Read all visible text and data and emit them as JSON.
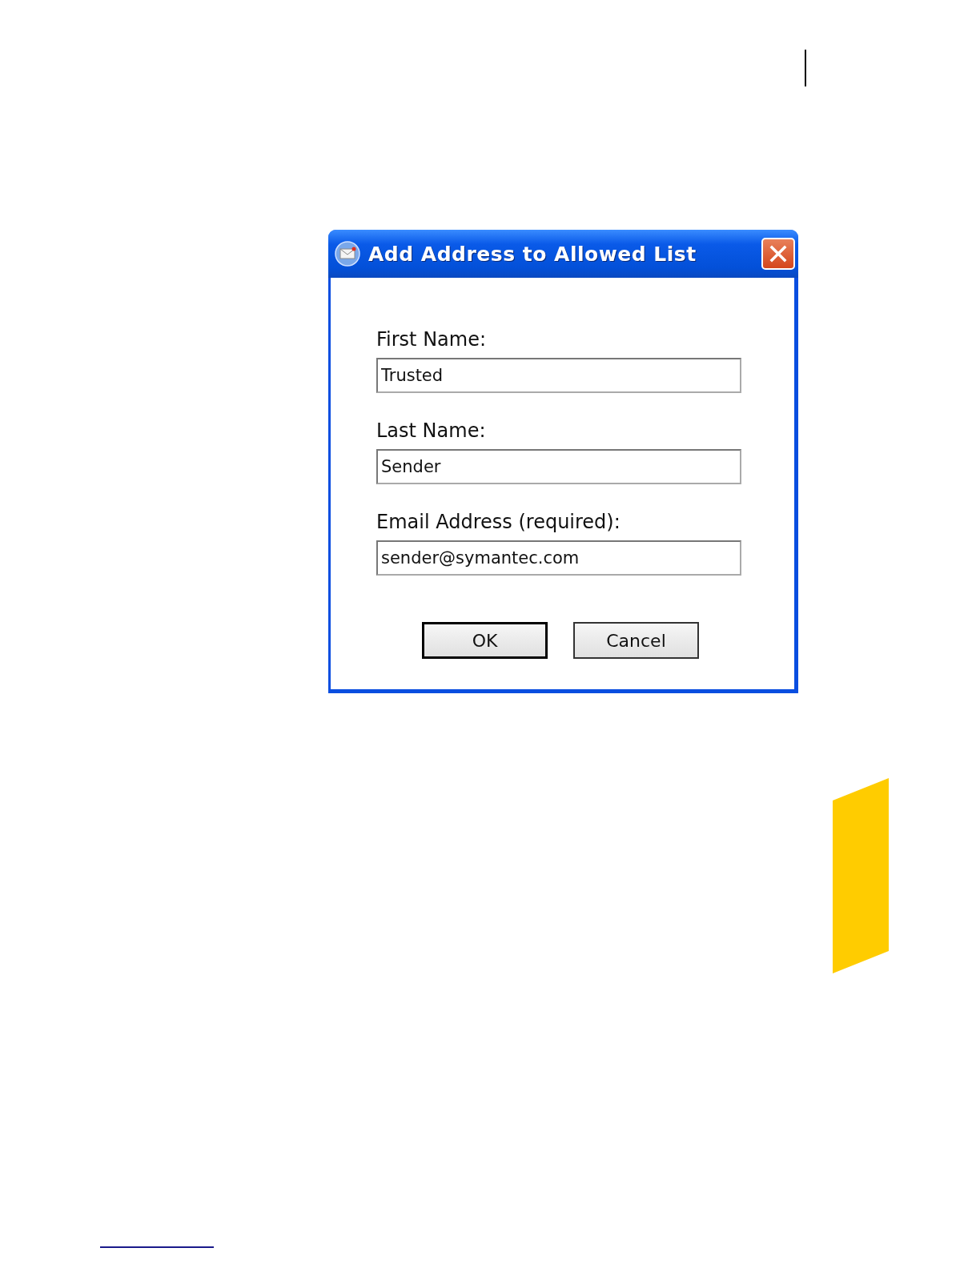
{
  "dialog": {
    "title": "Add Address to Allowed List",
    "fields": [
      {
        "label": "First Name:",
        "value": "Trusted"
      },
      {
        "label": "Last Name:",
        "value": "Sender"
      },
      {
        "label": "Email Address (required):",
        "value": "sender@symantec.com"
      }
    ],
    "buttons": [
      {
        "label": "OK",
        "default": true
      },
      {
        "label": "Cancel",
        "default": false
      }
    ]
  }
}
